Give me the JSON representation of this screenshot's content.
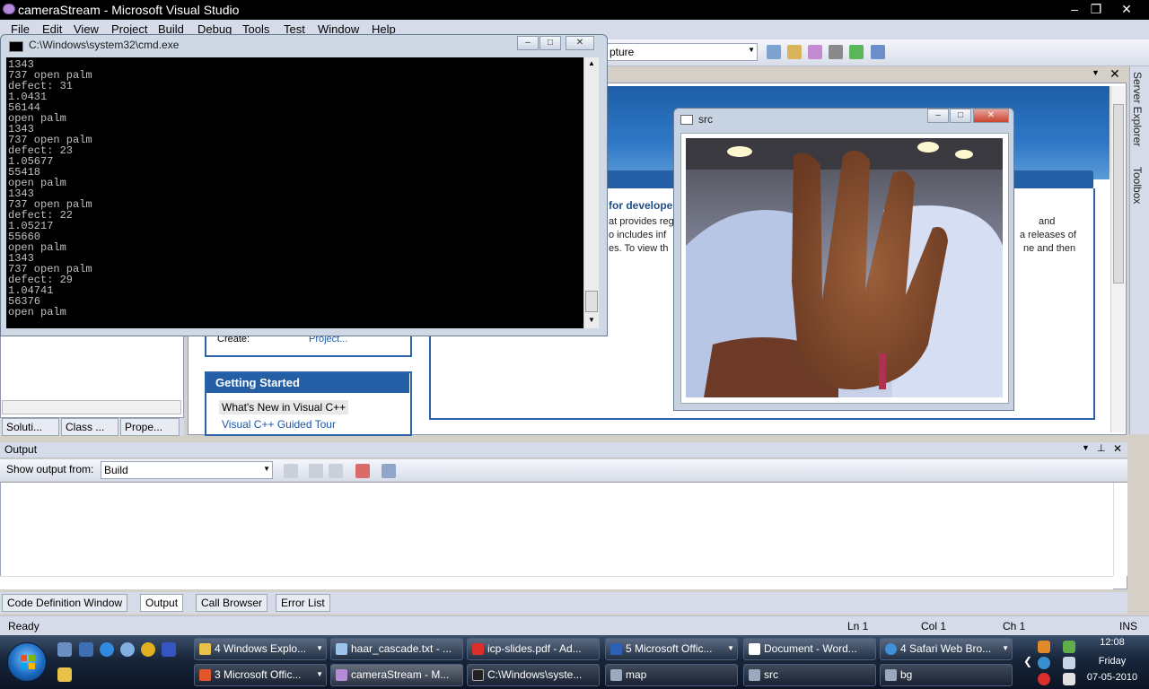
{
  "vs": {
    "title": "cameraStream - Microsoft Visual Studio",
    "menu": [
      "File",
      "Edit",
      "View",
      "Project",
      "Build",
      "Debug",
      "Tools",
      "Test",
      "Window",
      "Help"
    ],
    "toolbar_combo": "pture",
    "start_page": {
      "news_heading": "for develope",
      "news_lines": [
        "at provides reg",
        "o includes inf",
        "es. To view th"
      ],
      "news_right_lines": [
        "and",
        "a releases of",
        "ne and then"
      ],
      "recent_create_label": "Create:",
      "recent_create_link": "Project...",
      "getting_started_title": "Getting Started",
      "getting_started_items": [
        "What's New in Visual C++",
        "Visual C++ Guided Tour"
      ]
    },
    "right_tabs": [
      "Server Explorer",
      "Toolbox"
    ],
    "solution_tabs": [
      "Soluti...",
      "Class ...",
      "Prope..."
    ],
    "output": {
      "title": "Output",
      "show_from_label": "Show output from:",
      "show_from_value": "Build"
    },
    "bottom_tabs": [
      "Code Definition Window",
      "Output",
      "Call Browser",
      "Error List"
    ],
    "status": {
      "ready": "Ready",
      "ln": "Ln 1",
      "col": "Col 1",
      "ch": "Ch 1",
      "ins": "INS"
    }
  },
  "cmd": {
    "title": "C:\\Windows\\system32\\cmd.exe",
    "lines": [
      "1343",
      "737 open palm",
      "defect: 31",
      "1.0431",
      "56144",
      "open palm",
      "1343",
      "737 open palm",
      "defect: 23",
      "1.05677",
      "55418",
      "open palm",
      "1343",
      "737 open palm",
      "defect: 22",
      "1.05217",
      "55660",
      "open palm",
      "1343",
      "737 open palm",
      "defect: 29",
      "1.04741",
      "56376",
      "open palm"
    ]
  },
  "src": {
    "title": "src"
  },
  "taskbar": {
    "row1": [
      {
        "label": "4 Windows Explo...",
        "icon": "folder-icon",
        "color": "#e8c04a",
        "dropdown": true
      },
      {
        "label": "haar_cascade.txt - ...",
        "icon": "notepad-icon",
        "color": "#9cc4ea",
        "dropdown": false
      },
      {
        "label": "icp-slides.pdf - Ad...",
        "icon": "pdf-icon",
        "color": "#d9302c",
        "dropdown": false
      },
      {
        "label": "5 Microsoft Offic...",
        "icon": "word-icon",
        "color": "#2d5fb5",
        "dropdown": true
      },
      {
        "label": "Document - Word...",
        "icon": "document-icon",
        "color": "#ffffff",
        "dropdown": false
      },
      {
        "label": "4 Safari Web Bro...",
        "icon": "safari-icon",
        "color": "#3f8fd9",
        "dropdown": true
      }
    ],
    "row2": [
      {
        "label": "3 Microsoft Offic...",
        "icon": "office-icon",
        "color": "#e2572a",
        "dropdown": true
      },
      {
        "label": "cameraStream - M...",
        "icon": "visual-studio-icon",
        "color": "#b58bd6",
        "dropdown": false
      },
      {
        "label": "C:\\Windows\\syste...",
        "icon": "cmd-icon",
        "color": "#222222",
        "dropdown": false
      },
      {
        "label": "map",
        "icon": "window-icon",
        "color": "#9aa9c0",
        "dropdown": false
      },
      {
        "label": "src",
        "icon": "window-icon",
        "color": "#9aa9c0",
        "dropdown": false
      },
      {
        "label": "bg",
        "icon": "window-icon",
        "color": "#9aa9c0",
        "dropdown": false
      }
    ],
    "clock": {
      "time": "12:08",
      "day": "Friday",
      "date": "07-05-2010"
    }
  }
}
